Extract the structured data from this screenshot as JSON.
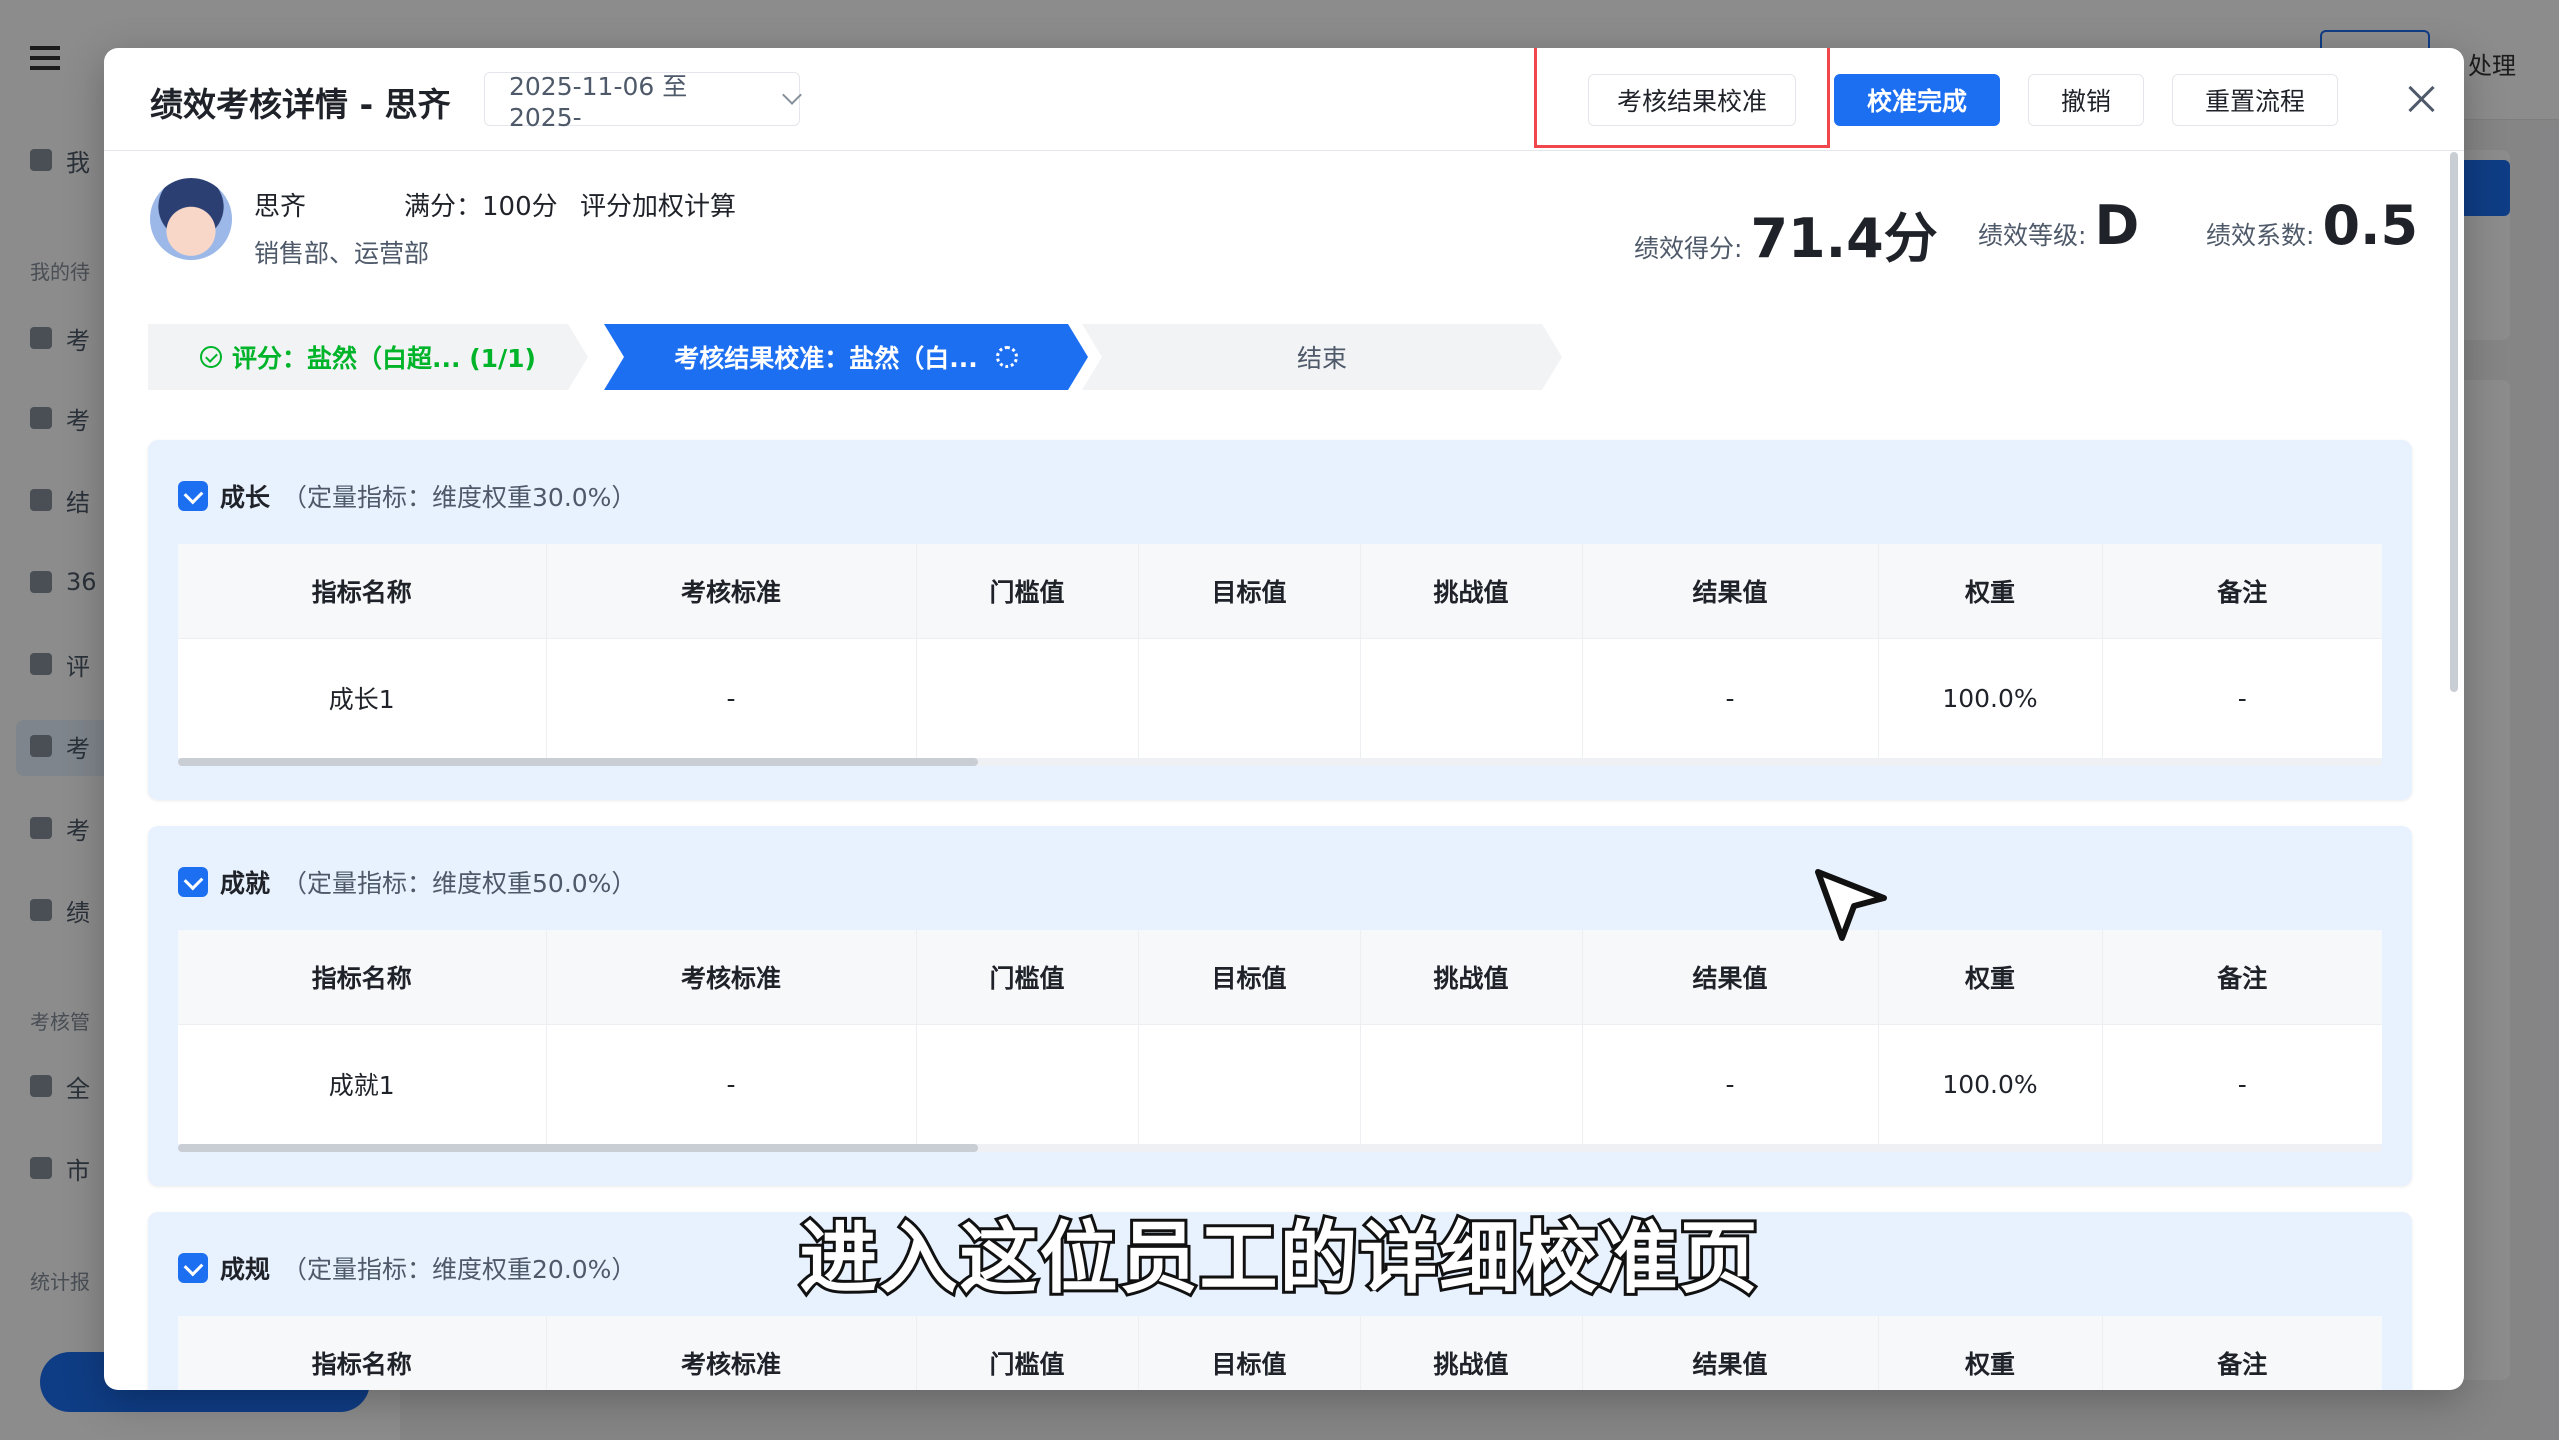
{
  "background": {
    "sidebar_items": [
      "我",
      "考",
      "考",
      "结",
      "36",
      "评",
      "考",
      "考",
      "绩",
      "全",
      "市"
    ],
    "sidebar_groups": [
      "我的待",
      "考核管",
      "统计报"
    ],
    "top_right_text": "处理"
  },
  "modal": {
    "title": "绩效考核详情 - 思齐",
    "date_range": "2025-11-06 至 2025-",
    "buttons": {
      "calibrate": "考核结果校准",
      "complete": "校准完成",
      "revoke": "撤销",
      "reset": "重置流程"
    },
    "profile": {
      "name": "思齐",
      "full_score": "满分：100分",
      "method": "评分加权计算",
      "departments": "销售部、运营部"
    },
    "metrics": {
      "score_label": "绩效得分:",
      "score_value": "71.4分",
      "grade_label": "绩效等级:",
      "grade_value": "D",
      "coef_label": "绩效系数:",
      "coef_value": "0.5"
    },
    "steps": [
      {
        "label": "评分：盐然（白超... (1/1)",
        "status": "done"
      },
      {
        "label": "考核结果校准：盐然（白...",
        "status": "active"
      },
      {
        "label": "结束",
        "status": "pending"
      }
    ],
    "table_headers": [
      "指标名称",
      "考核标准",
      "门槛值",
      "目标值",
      "挑战值",
      "结果值",
      "权重",
      "备注"
    ],
    "sections": [
      {
        "name": "成长",
        "subtitle": "（定量指标：维度权重30.0%）",
        "rows": [
          [
            "成长1",
            "-",
            "",
            "",
            "",
            "-",
            "100.0%",
            "-"
          ]
        ]
      },
      {
        "name": "成就",
        "subtitle": "（定量指标：维度权重50.0%）",
        "rows": [
          [
            "成就1",
            "-",
            "",
            "",
            "",
            "-",
            "100.0%",
            "-"
          ]
        ]
      },
      {
        "name": "成规",
        "subtitle": "（定量指标：维度权重20.0%）",
        "rows": []
      }
    ]
  },
  "caption": "进入这位员工的详细校准页",
  "colors": {
    "primary": "#1d6ff2",
    "success": "#00b42a",
    "highlight": "#f0464c"
  }
}
